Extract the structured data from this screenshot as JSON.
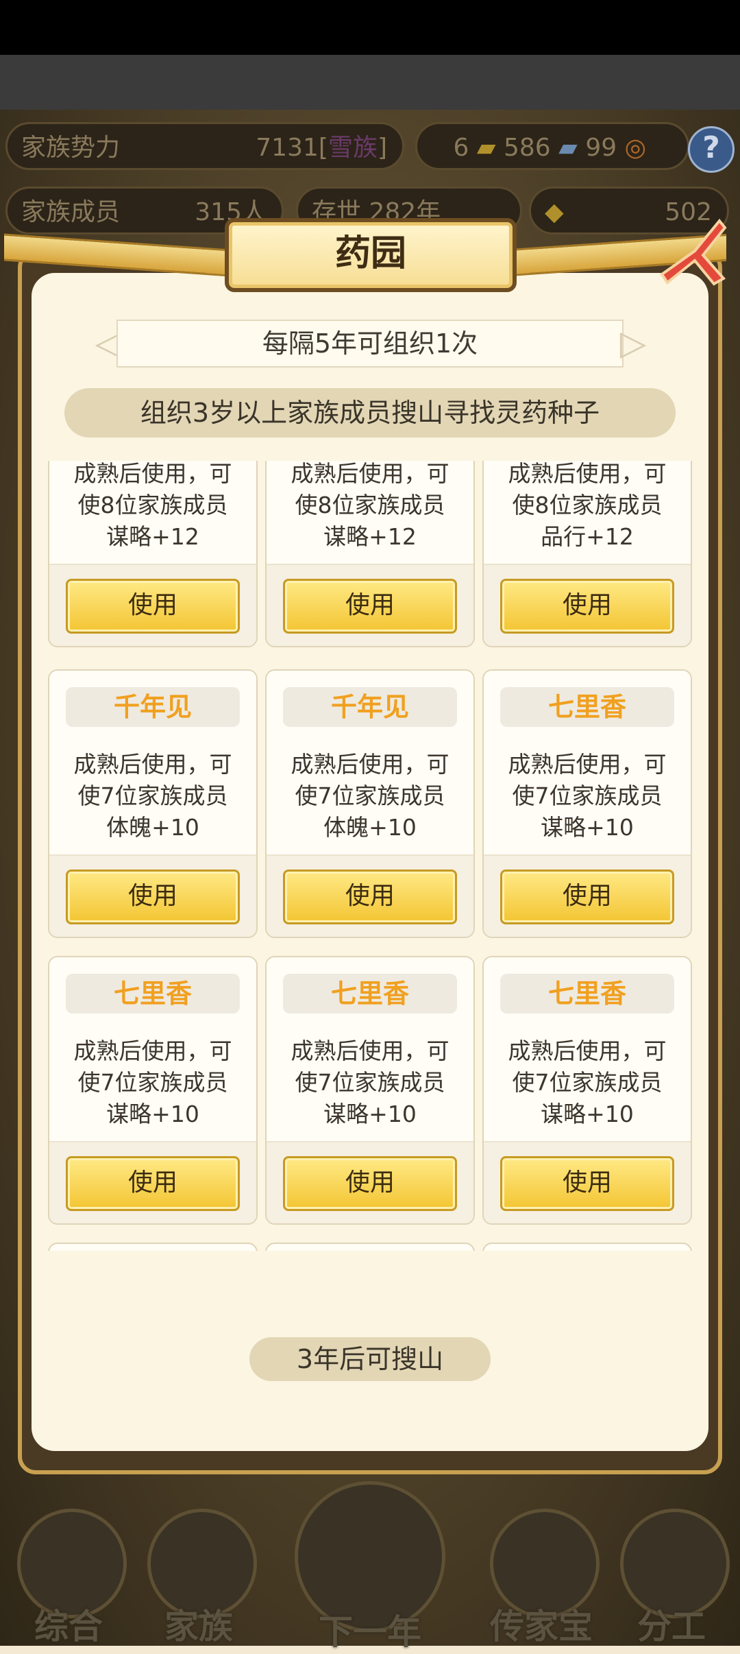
{
  "background": {
    "family_power_label": "家族势力",
    "family_power_value": "7131[",
    "family_power_rank": "雪族",
    "family_power_bracket": "]",
    "currency_a": "6",
    "currency_b": "586",
    "currency_c": "99",
    "family_members_label": "家族成员",
    "family_members_value": "315人",
    "existence_label": "存世",
    "existence_value": "282年",
    "gold_value": "502",
    "help_symbol": "?"
  },
  "nav": {
    "items": [
      {
        "label": "综合"
      },
      {
        "label": "家族"
      },
      {
        "label": "下一年"
      },
      {
        "label": "传家宝"
      },
      {
        "label": "分工"
      }
    ]
  },
  "modal": {
    "title": "药园",
    "subtitle": "每隔5年可组织1次",
    "description": "组织3岁以上家族成员搜山寻找灵药种子",
    "search_status": "3年后可搜山",
    "use_label": "使用",
    "cards": [
      {
        "name": "",
        "line1": "成熟后使用，可",
        "line2": "使8位家族成员",
        "line3": "谋略+12"
      },
      {
        "name": "",
        "line1": "成熟后使用，可",
        "line2": "使8位家族成员",
        "line3": "谋略+12"
      },
      {
        "name": "",
        "line1": "成熟后使用，可",
        "line2": "使8位家族成员",
        "line3": "品行+12"
      },
      {
        "name": "千年见",
        "line1": "成熟后使用，可",
        "line2": "使7位家族成员",
        "line3": "体魄+10"
      },
      {
        "name": "千年见",
        "line1": "成熟后使用，可",
        "line2": "使7位家族成员",
        "line3": "体魄+10"
      },
      {
        "name": "七里香",
        "line1": "成熟后使用，可",
        "line2": "使7位家族成员",
        "line3": "谋略+10"
      },
      {
        "name": "七里香",
        "line1": "成熟后使用，可",
        "line2": "使7位家族成员",
        "line3": "谋略+10"
      },
      {
        "name": "七里香",
        "line1": "成熟后使用，可",
        "line2": "使7位家族成员",
        "line3": "谋略+10"
      },
      {
        "name": "七里香",
        "line1": "成熟后使用，可",
        "line2": "使7位家族成员",
        "line3": "谋略+10"
      }
    ]
  },
  "colors": {
    "accent_gold": "#f3c533",
    "herb_name": "#f0a020",
    "panel_bg": "#fbf5e2"
  }
}
